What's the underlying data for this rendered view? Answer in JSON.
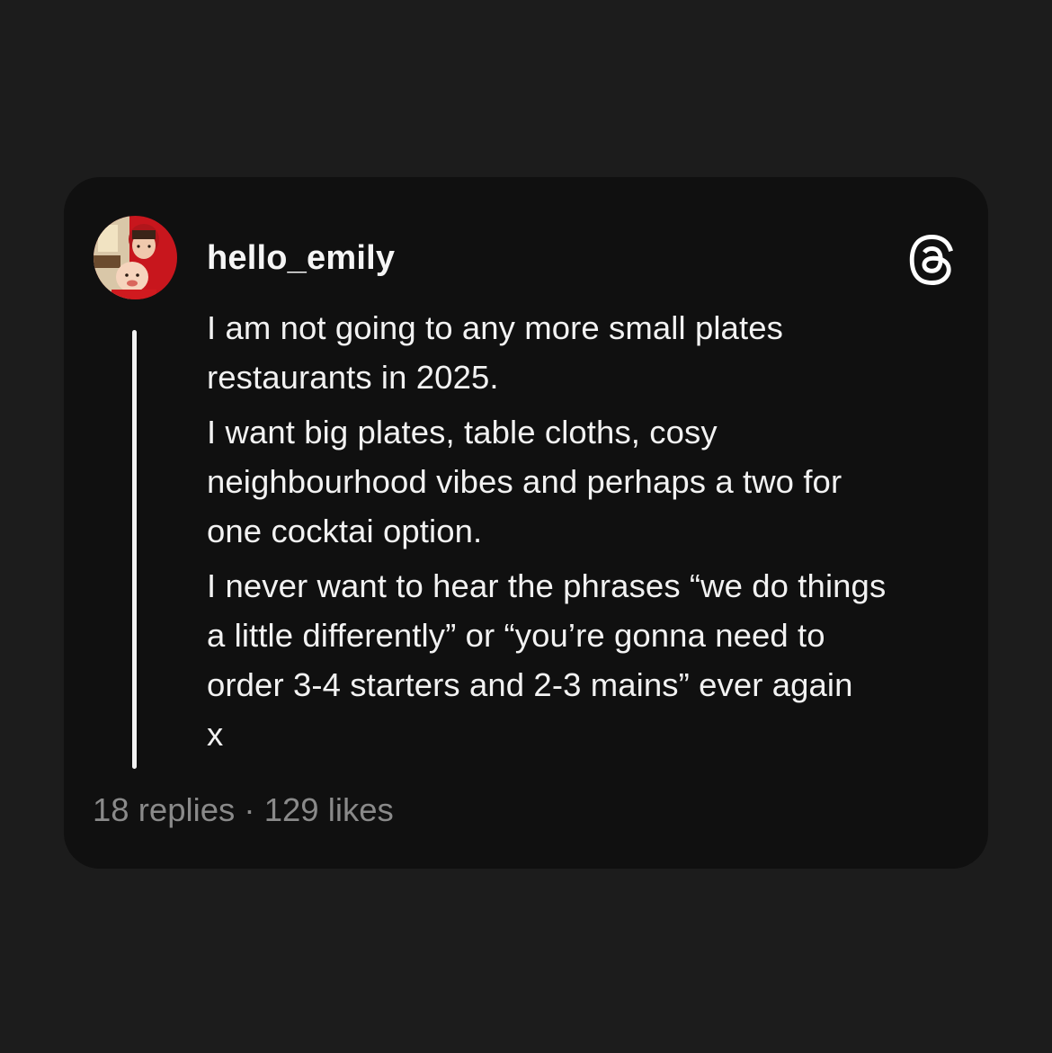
{
  "post": {
    "username": "hello_emily",
    "paragraphs": [
      "I am not going to any more small plates\nrestaurants in 2025.",
      "I want big plates, table cloths, cosy\nneighbourhood vibes and perhaps a two for\none cocktai option.",
      "I never want to hear the phrases “we do things\na little differently” or “you’re gonna need to\norder 3-4 starters and 2-3 mains” ever again\nx"
    ],
    "replies": "18 replies",
    "separator": " · ",
    "likes": "129 likes"
  },
  "icons": {
    "brand": "threads-logo-icon",
    "avatar": "profile-photo"
  },
  "colors": {
    "page_background": "#1c1c1c",
    "card_background": "#101010",
    "text_primary": "#f2f2f2",
    "text_secondary": "#8a8a8a",
    "avatar_ring": "#c8161d"
  }
}
